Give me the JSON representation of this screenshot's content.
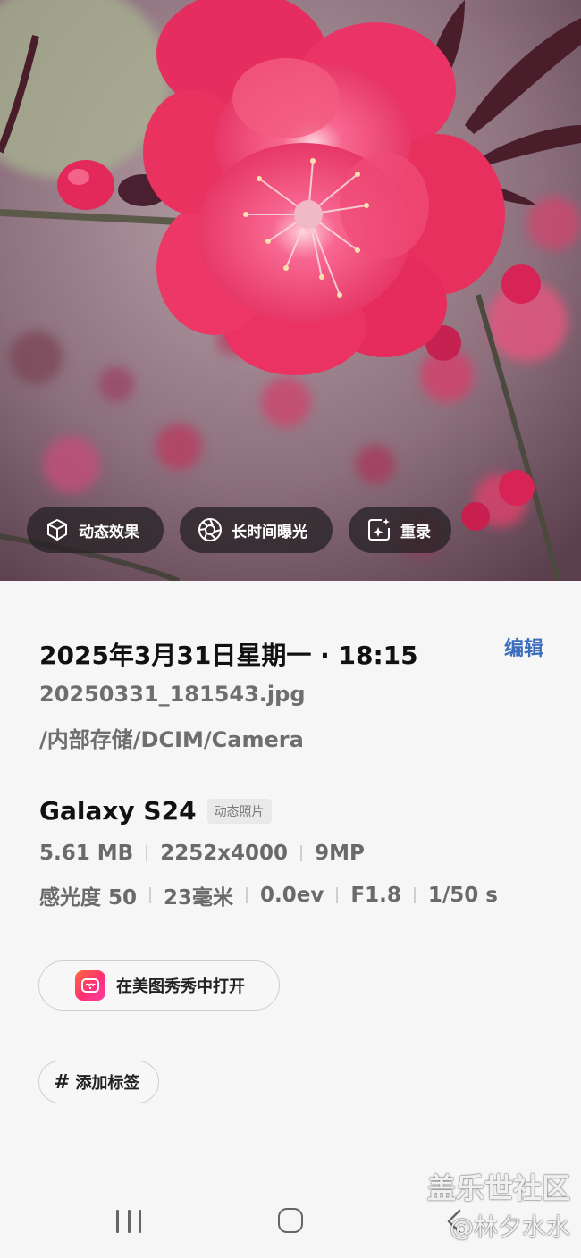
{
  "photo_actions": {
    "motion_effect": "动态效果",
    "long_exposure": "长时间曝光",
    "remaster": "重录"
  },
  "details": {
    "datetime": "2025年3月31日星期一 · 18:15",
    "edit_label": "编辑",
    "file_name": "20250331_181543.jpg",
    "file_path": "/内部存储/DCIM/Camera",
    "device": "Galaxy S24",
    "device_tag": "动态照片",
    "file_size": "5.61 MB",
    "resolution": "2252x4000",
    "megapixels": "9MP",
    "iso": "感光度 50",
    "focal_length": "23毫米",
    "exposure_value": "0.0ev",
    "aperture": "F1.8",
    "shutter": "1/50 s"
  },
  "open_in_app": {
    "label": "在美图秀秀中打开",
    "icon": "meitu-app-icon"
  },
  "add_tag": {
    "symbol": "#",
    "label": "添加标签"
  },
  "watermark": {
    "line1": "盖乐世社区",
    "line2": "@林夕水水"
  },
  "colors": {
    "accent": "#3c6ebd",
    "flower": "#f0386a",
    "chip_bg": "#262325"
  },
  "navbar": {
    "icons": [
      "recents-icon",
      "home-icon",
      "back-icon"
    ]
  }
}
